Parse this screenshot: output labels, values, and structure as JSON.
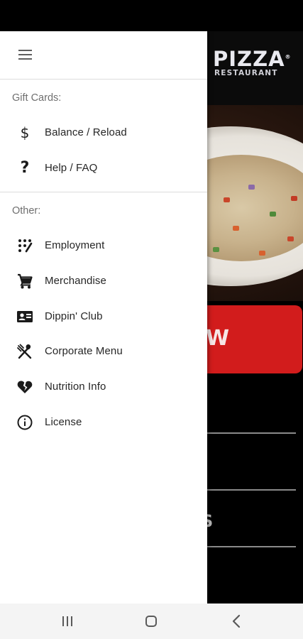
{
  "background_app": {
    "logo_main": "PIZZA",
    "logo_mark": "®",
    "logo_sub": "RESTAURANT",
    "order_button_partial": "W",
    "partial_letter": "S",
    "accent_color": "#d21c1c"
  },
  "drawer": {
    "menu_icon": "hamburger-menu-icon",
    "sections": [
      {
        "label": "Gift Cards:",
        "items": [
          {
            "label": "Balance / Reload",
            "icon": "dollar-icon"
          },
          {
            "label": "Help / FAQ",
            "icon": "question-icon"
          }
        ]
      },
      {
        "label": "Other:",
        "items": [
          {
            "label": "Employment",
            "icon": "dialpad-icon"
          },
          {
            "label": "Merchandise",
            "icon": "cart-icon"
          },
          {
            "label": "Dippin' Club",
            "icon": "contact-card-icon"
          },
          {
            "label": "Corporate Menu",
            "icon": "utensils-icon"
          },
          {
            "label": "Nutrition Info",
            "icon": "broken-heart-icon"
          },
          {
            "label": "License",
            "icon": "info-icon"
          }
        ]
      }
    ]
  },
  "navbar": {
    "recents_icon": "recents-icon",
    "home_icon": "home-icon",
    "back_icon": "back-icon"
  }
}
